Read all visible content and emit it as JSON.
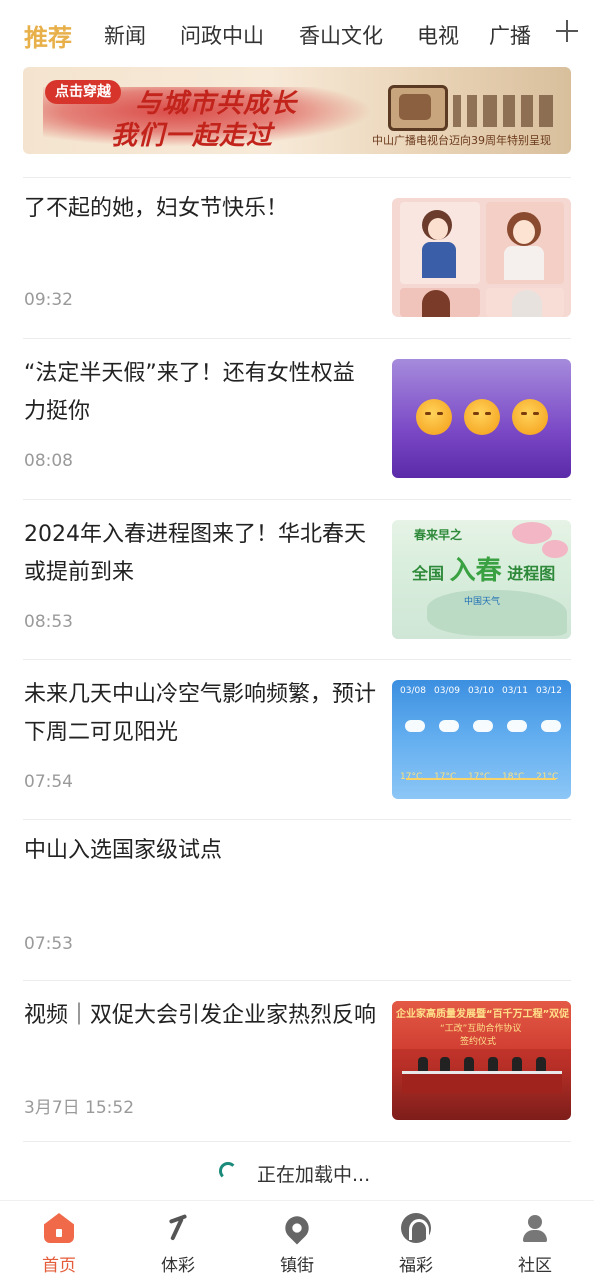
{
  "tabs": [
    {
      "label": "推荐",
      "active": true
    },
    {
      "label": "新闻",
      "active": false
    },
    {
      "label": "问政中山",
      "active": false
    },
    {
      "label": "香山文化",
      "active": false
    },
    {
      "label": "电视",
      "active": false
    },
    {
      "label": "广播",
      "active": false
    }
  ],
  "tab_add_icon": "plus-icon",
  "banner": {
    "button_label": "点击穿越",
    "headline_line1": "与城市共成长",
    "headline_line2": "我们一起走过",
    "caption": "中山广播电视台迈向39周年特别呈现"
  },
  "news": [
    {
      "title": "了不起的她，妇女节快乐！",
      "time": "09:32",
      "thumbnail": "illustrated-women"
    },
    {
      "title": "“法定半天假”来了！还有女性权益力挺你",
      "time": "08:08",
      "thumbnail": "emoji-faces"
    },
    {
      "title": "2024年入春进程图来了！华北春天或提前到来",
      "time": "08:53",
      "thumbnail": "spring-map",
      "thumbnail_text": {
        "line_a": "春来早之",
        "line_b_pre": "全国",
        "line_b_big": "入春",
        "line_b_post": "进程图",
        "logo": "中国天气"
      }
    },
    {
      "title": "未来几天中山冷空气影响频繁，预计下周二可见阳光",
      "time": "07:54",
      "thumbnail": "weather-forecast",
      "thumbnail_text": {
        "dates": [
          "03/08",
          "03/09",
          "03/10",
          "03/11",
          "03/12"
        ],
        "highs": [
          "17°C",
          "17°C",
          "17°C",
          "18°C",
          "21°C"
        ]
      }
    },
    {
      "title": "中山入选国家级试点",
      "time": "07:53",
      "thumbnail": null
    },
    {
      "title": "视频｜双促大会引发企业家热烈反响",
      "time": "3月7日 15:52",
      "thumbnail": "meeting-stage",
      "thumbnail_text": {
        "banner": "企业家高质量发展暨“百千万工程”双促",
        "sub": "“工改”互助合作协议",
        "sign": "签约仪式"
      }
    }
  ],
  "loading": {
    "text": "正在加载中..."
  },
  "bottom_nav": [
    {
      "label": "首页",
      "icon": "home-icon",
      "active": true
    },
    {
      "label": "体彩",
      "icon": "sport-lottery-icon",
      "active": false
    },
    {
      "label": "镇街",
      "icon": "location-pin-icon",
      "active": false
    },
    {
      "label": "福彩",
      "icon": "welfare-lottery-icon",
      "active": false
    },
    {
      "label": "社区",
      "icon": "community-icon",
      "active": false
    }
  ],
  "colors": {
    "accent": "#e8b04a",
    "nav_active": "#e45c3a",
    "time_gray": "#9a9a9a"
  }
}
